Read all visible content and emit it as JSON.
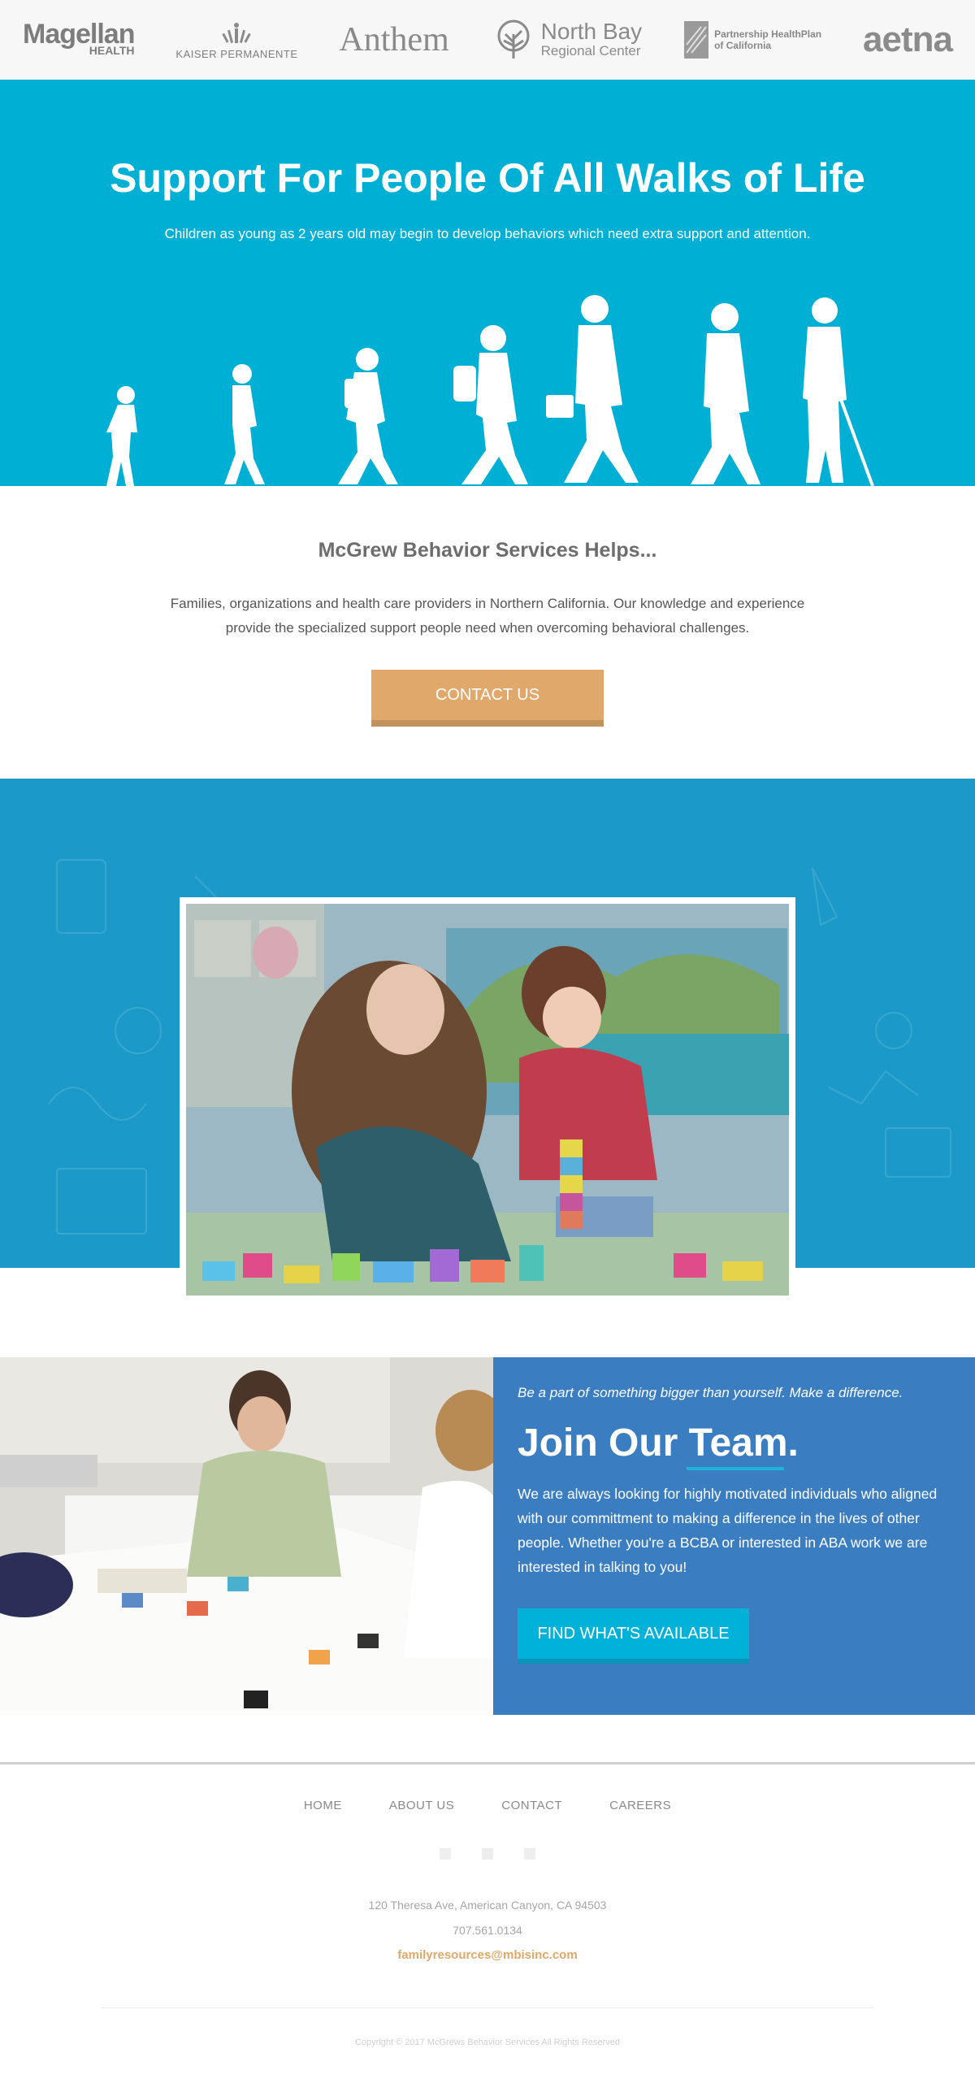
{
  "logos": {
    "magellan": {
      "line1": "Magellan",
      "line2": "HEALTH"
    },
    "kaiser": {
      "name": "KAISER PERMANENTE"
    },
    "anthem": {
      "name": "Anthem"
    },
    "northbay": {
      "line1": "North Bay",
      "line2": "Regional Center"
    },
    "partnership": {
      "line1": "Partnership HealthPlan",
      "line2": "of California"
    },
    "aetna": {
      "name": "aetna"
    }
  },
  "hero": {
    "title": "Support For People Of All Walks of Life",
    "subtitle": "Children as young as 2 years old may begin to develop behaviors which need extra support and attention."
  },
  "helps": {
    "title": "McGrew Behavior Services Helps...",
    "body": "Families, organizations and health care providers in Northern California. Our knowledge and experience provide the specialized support people need when overcoming behavioral challenges.",
    "button": "CONTACT US"
  },
  "team": {
    "tagline": "Be a part of something bigger than yourself. Make a difference.",
    "title": "Join Our Team.",
    "body": "We are always looking for highly motivated individuals who aligned with our committment to making a difference in the lives of other people. Whether you're a BCBA or interested in ABA work we are interested in talking to you!",
    "button": "FIND WHAT'S AVAILABLE"
  },
  "footer": {
    "nav": [
      "HOME",
      "ABOUT US",
      "CONTACT",
      "CAREERS"
    ],
    "address": "120 Theresa Ave, American Canyon, CA 94503",
    "phone": "707.561.0134",
    "email": "familyresources@mbisinc.com",
    "copyright": "Copyright © 2017 McGrews Behavior Services All Rights Reserved"
  },
  "colors": {
    "hero_bg": "#00b0d4",
    "band_bg": "#1b9ac9",
    "team_panel": "#3b7dc1",
    "contact_button": "#e0a86b",
    "find_button": "#00b2d8",
    "email": "#e0a868"
  }
}
